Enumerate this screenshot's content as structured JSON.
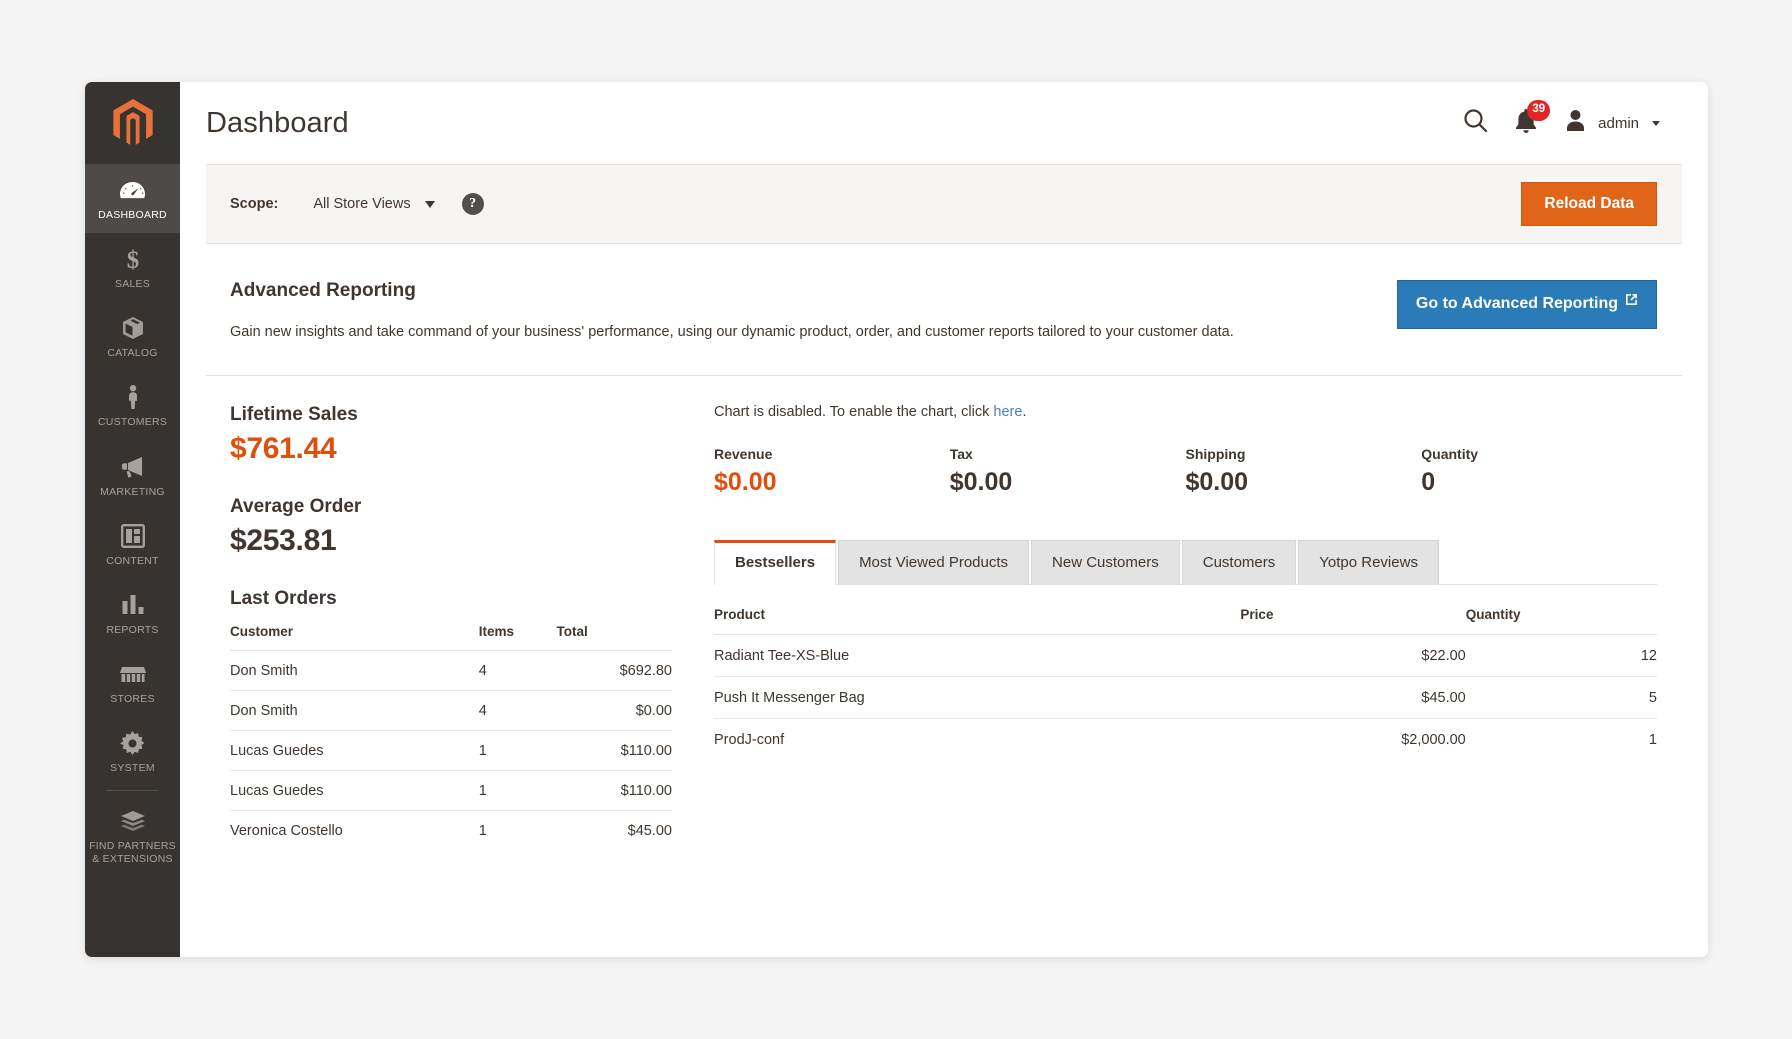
{
  "header": {
    "title": "Dashboard",
    "search_icon": "search-icon",
    "notifications_icon": "bell-icon",
    "notifications_count": "39",
    "user_icon": "user-avatar-icon",
    "admin_label": "admin"
  },
  "sidebar": {
    "logo": "magento-logo-icon",
    "items": [
      {
        "label": "Dashboard",
        "icon": "gauge-icon",
        "active": true
      },
      {
        "label": "Sales",
        "icon": "dollar-icon",
        "active": false
      },
      {
        "label": "Catalog",
        "icon": "box-icon",
        "active": false
      },
      {
        "label": "Customers",
        "icon": "person-icon",
        "active": false
      },
      {
        "label": "Marketing",
        "icon": "megaphone-icon",
        "active": false
      },
      {
        "label": "Content",
        "icon": "layout-icon",
        "active": false
      },
      {
        "label": "Reports",
        "icon": "bar-chart-icon",
        "active": false
      },
      {
        "label": "Stores",
        "icon": "storefront-icon",
        "active": false
      },
      {
        "label": "System",
        "icon": "gear-icon",
        "active": false
      },
      {
        "label": "Find Partners & Extensions",
        "icon": "bricks-icon",
        "active": false
      }
    ]
  },
  "scope_bar": {
    "label": "Scope:",
    "value": "All Store Views",
    "help_icon": "question-mark-icon",
    "reload_label": "Reload Data"
  },
  "advanced_reporting": {
    "title": "Advanced Reporting",
    "description": "Gain new insights and take command of your business' performance, using our dynamic product, order, and customer reports tailored to your customer data.",
    "button_label": "Go to Advanced Reporting",
    "button_icon": "external-link-icon"
  },
  "summary": {
    "lifetime_sales_label": "Lifetime Sales",
    "lifetime_sales_value": "$761.44",
    "average_order_label": "Average Order",
    "average_order_value": "$253.81"
  },
  "last_orders": {
    "title": "Last Orders",
    "columns": [
      "Customer",
      "Items",
      "Total"
    ],
    "rows": [
      {
        "customer": "Don Smith",
        "items": "4",
        "total": "$692.80"
      },
      {
        "customer": "Don Smith",
        "items": "4",
        "total": "$0.00"
      },
      {
        "customer": "Lucas Guedes",
        "items": "1",
        "total": "$110.00"
      },
      {
        "customer": "Lucas Guedes",
        "items": "1",
        "total": "$110.00"
      },
      {
        "customer": "Veronica Costello",
        "items": "1",
        "total": "$45.00"
      }
    ]
  },
  "chart": {
    "note_before": "Chart is disabled. To enable the chart, click ",
    "note_link": "here",
    "note_after": ".",
    "kpis": [
      {
        "label": "Revenue",
        "value": "$0.00",
        "accent": true
      },
      {
        "label": "Tax",
        "value": "$0.00",
        "accent": false
      },
      {
        "label": "Shipping",
        "value": "$0.00",
        "accent": false
      },
      {
        "label": "Quantity",
        "value": "0",
        "accent": false
      }
    ]
  },
  "tabs": [
    {
      "label": "Bestsellers",
      "active": true
    },
    {
      "label": "Most Viewed Products",
      "active": false
    },
    {
      "label": "New Customers",
      "active": false
    },
    {
      "label": "Customers",
      "active": false
    },
    {
      "label": "Yotpo Reviews",
      "active": false
    }
  ],
  "bestsellers": {
    "columns": [
      "Product",
      "Price",
      "Quantity"
    ],
    "rows": [
      {
        "product": "Radiant Tee-XS-Blue",
        "price": "$22.00",
        "quantity": "12"
      },
      {
        "product": "Push It Messenger Bag",
        "price": "$45.00",
        "quantity": "5"
      },
      {
        "product": "ProdJ-conf",
        "price": "$2,000.00",
        "quantity": "1"
      }
    ]
  },
  "colors": {
    "accent_orange": "#e04e0a",
    "button_orange": "#e06518",
    "button_blue": "#2a7bb8",
    "badge_red": "#e22626",
    "sidebar_dark": "#373330",
    "link_blue": "#4a81c4"
  }
}
